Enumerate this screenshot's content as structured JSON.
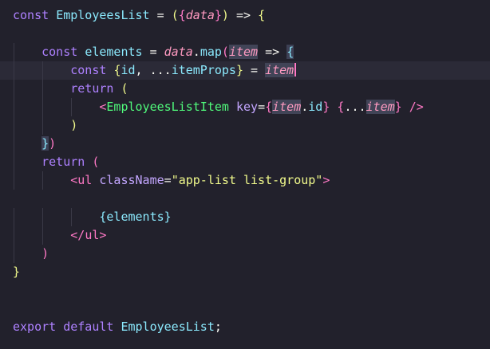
{
  "editor": {
    "lines": [
      [
        {
          "t": "const ",
          "c": "kw"
        },
        {
          "t": "EmployeesList",
          "c": "fn"
        },
        {
          "t": " = ",
          "c": "plain"
        },
        {
          "t": "(",
          "c": "b1"
        },
        {
          "t": "{",
          "c": "b2"
        },
        {
          "t": "data",
          "c": "arg"
        },
        {
          "t": "}",
          "c": "b2"
        },
        {
          "t": ")",
          "c": "b1"
        },
        {
          "t": " => ",
          "c": "plain"
        },
        {
          "t": "{",
          "c": "b1"
        }
      ],
      [],
      [
        {
          "t": "    const ",
          "c": "kw"
        },
        {
          "t": "elements",
          "c": "fn"
        },
        {
          "t": " = ",
          "c": "plain"
        },
        {
          "t": "data",
          "c": "arg"
        },
        {
          "t": ".",
          "c": "plain"
        },
        {
          "t": "map",
          "c": "fn"
        },
        {
          "t": "(",
          "c": "b2"
        },
        {
          "t": "item",
          "c": "arg",
          "h": "hl"
        },
        {
          "t": " => ",
          "c": "plain"
        },
        {
          "t": "{",
          "c": "b3",
          "h": "bm"
        }
      ],
      [
        {
          "t": "        const ",
          "c": "kw"
        },
        {
          "t": "{",
          "c": "b1"
        },
        {
          "t": "id",
          "c": "var"
        },
        {
          "t": ", ...",
          "c": "plain"
        },
        {
          "t": "itemProps",
          "c": "var"
        },
        {
          "t": "}",
          "c": "b1"
        },
        {
          "t": " = ",
          "c": "plain"
        },
        {
          "t": "item",
          "c": "arg",
          "h": "hl",
          "caret": true
        }
      ],
      [
        {
          "t": "        return ",
          "c": "kw"
        },
        {
          "t": "(",
          "c": "b1"
        }
      ],
      [
        {
          "t": "            <",
          "c": "tagc"
        },
        {
          "t": "EmployeesListItem",
          "c": "comp"
        },
        {
          "t": " key",
          "c": "prop"
        },
        {
          "t": "=",
          "c": "plain"
        },
        {
          "t": "{",
          "c": "b2"
        },
        {
          "t": "item",
          "c": "arg",
          "h": "hl"
        },
        {
          "t": ".",
          "c": "plain"
        },
        {
          "t": "id",
          "c": "var"
        },
        {
          "t": "}",
          "c": "b2"
        },
        {
          "t": " ",
          "c": "plain"
        },
        {
          "t": "{",
          "c": "b2"
        },
        {
          "t": "...",
          "c": "plain"
        },
        {
          "t": "item",
          "c": "arg",
          "h": "hl"
        },
        {
          "t": "}",
          "c": "b2"
        },
        {
          "t": " />",
          "c": "tagc"
        }
      ],
      [
        {
          "t": "        )",
          "c": "b1"
        }
      ],
      [
        {
          "t": "    ",
          "c": "plain"
        },
        {
          "t": "}",
          "c": "b3",
          "h": "bm"
        },
        {
          "t": ")",
          "c": "b2"
        }
      ],
      [
        {
          "t": "    return ",
          "c": "kw"
        },
        {
          "t": "(",
          "c": "b2"
        }
      ],
      [
        {
          "t": "        <",
          "c": "tagc"
        },
        {
          "t": "ul",
          "c": "tagc"
        },
        {
          "t": " className",
          "c": "prop"
        },
        {
          "t": "=",
          "c": "plain"
        },
        {
          "t": "\"app-list list-group\"",
          "c": "str"
        },
        {
          "t": ">",
          "c": "tagc"
        }
      ],
      [],
      [
        {
          "t": "            ",
          "c": "plain"
        },
        {
          "t": "{",
          "c": "b3"
        },
        {
          "t": "elements",
          "c": "fn"
        },
        {
          "t": "}",
          "c": "b3"
        }
      ],
      [
        {
          "t": "        </",
          "c": "tagc"
        },
        {
          "t": "ul",
          "c": "tagc"
        },
        {
          "t": ">",
          "c": "tagc"
        }
      ],
      [
        {
          "t": "    )",
          "c": "b2"
        }
      ],
      [
        {
          "t": "}",
          "c": "b1"
        }
      ],
      [],
      [],
      [
        {
          "t": "export ",
          "c": "kw"
        },
        {
          "t": "default ",
          "c": "kw"
        },
        {
          "t": "EmployeesList",
          "c": "fn"
        },
        {
          "t": ";",
          "c": "plain"
        }
      ]
    ],
    "colors": {
      "background": "#22212c",
      "keyword": "#ae81ff",
      "function": "#8be9fd",
      "component": "#50fa7b",
      "tag": "#ff79c6",
      "parameter": "#ff9ac1",
      "string": "#f1fa8c",
      "word_highlight": "#414457",
      "cursor": "#ff79c6"
    }
  }
}
